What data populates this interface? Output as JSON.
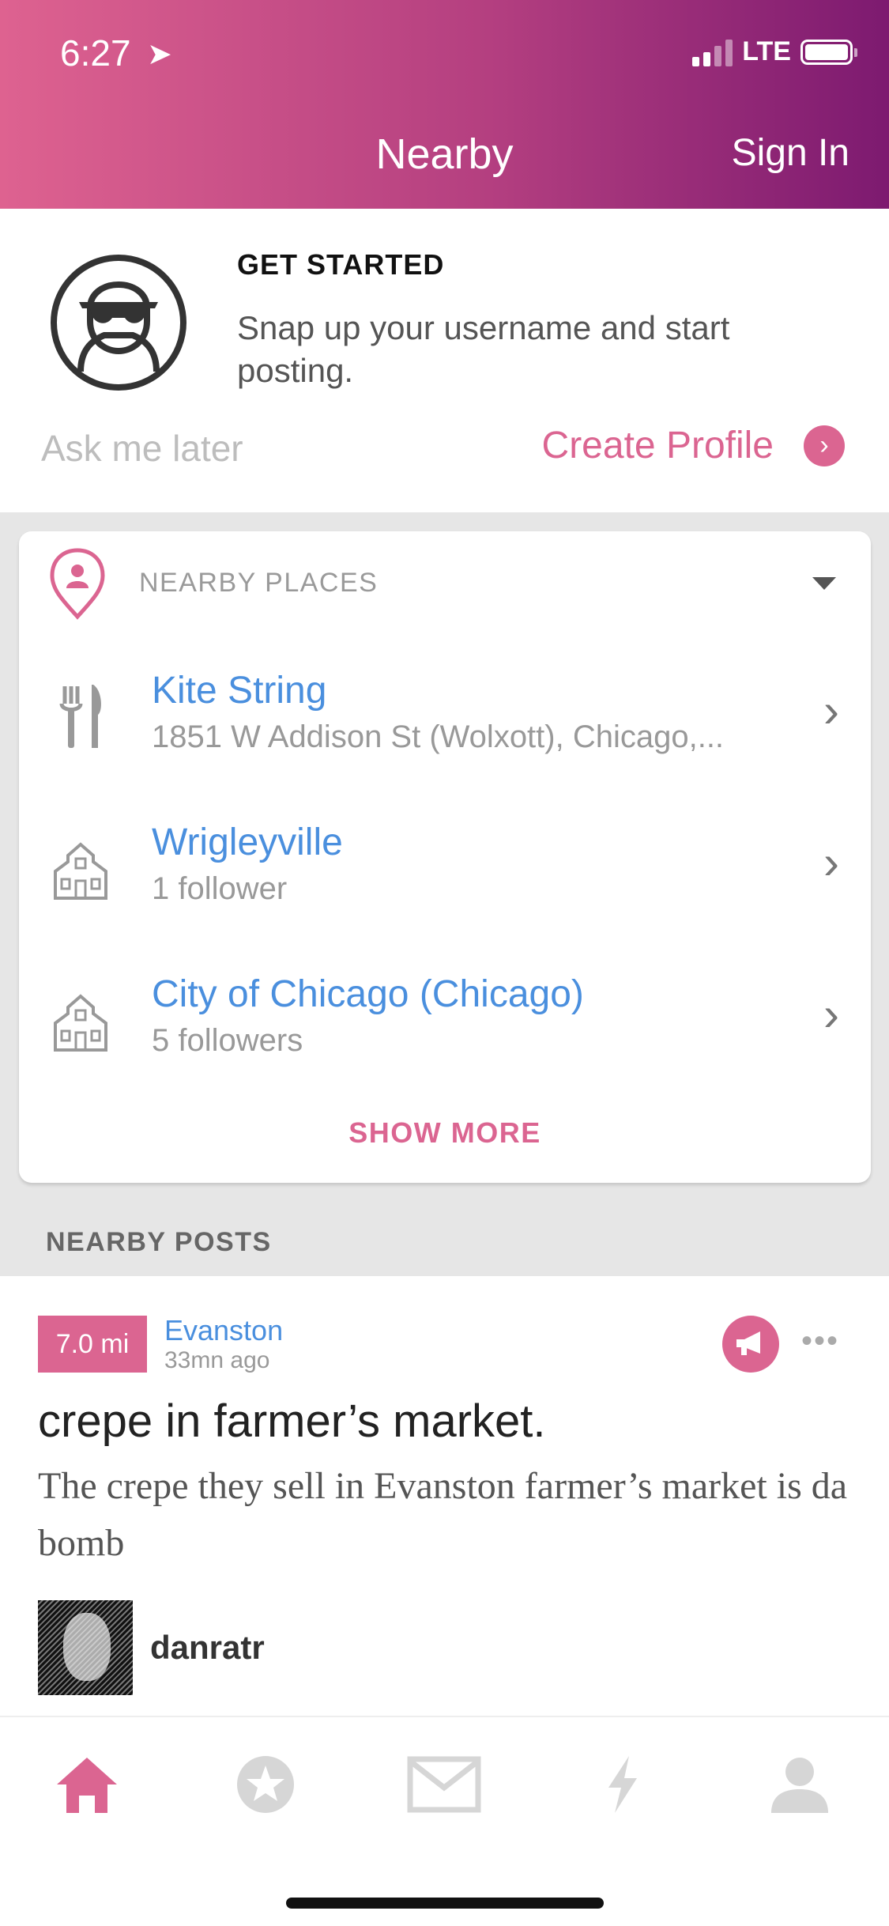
{
  "status_bar": {
    "time": "6:27",
    "network": "LTE"
  },
  "header": {
    "title": "Nearby",
    "sign_in": "Sign In"
  },
  "get_started": {
    "title": "GET STARTED",
    "text": "Snap up your username and start posting.",
    "ask_later": "Ask me later",
    "create_profile": "Create Profile"
  },
  "nearby_places": {
    "title": "NEARBY PLACES",
    "items": [
      {
        "name": "Kite String",
        "sub": "1851 W Addison St (Wolxott), Chicago,...",
        "icon": "fork-knife-icon"
      },
      {
        "name": "Wrigleyville",
        "sub": "1 follower",
        "icon": "buildings-icon"
      },
      {
        "name": "City of Chicago (Chicago)",
        "sub": "5 followers",
        "icon": "buildings-icon"
      }
    ],
    "show_more": "SHOW MORE"
  },
  "nearby_posts": {
    "title": "NEARBY POSTS",
    "post": {
      "distance": "7.0 mi",
      "place": "Evanston",
      "time": "33mn ago",
      "title": "crepe in farmer’s market.",
      "body": "The crepe they sell in Evanston farmer’s market is da bomb",
      "author": "danratr",
      "more": "•••"
    }
  },
  "tabbar": [
    "home-icon",
    "star-icon",
    "mail-icon",
    "bolt-icon",
    "person-icon"
  ],
  "colors": {
    "accent": "#db6591",
    "link": "#4a8fde",
    "header_start": "#de6290",
    "header_end": "#7d1a70"
  }
}
